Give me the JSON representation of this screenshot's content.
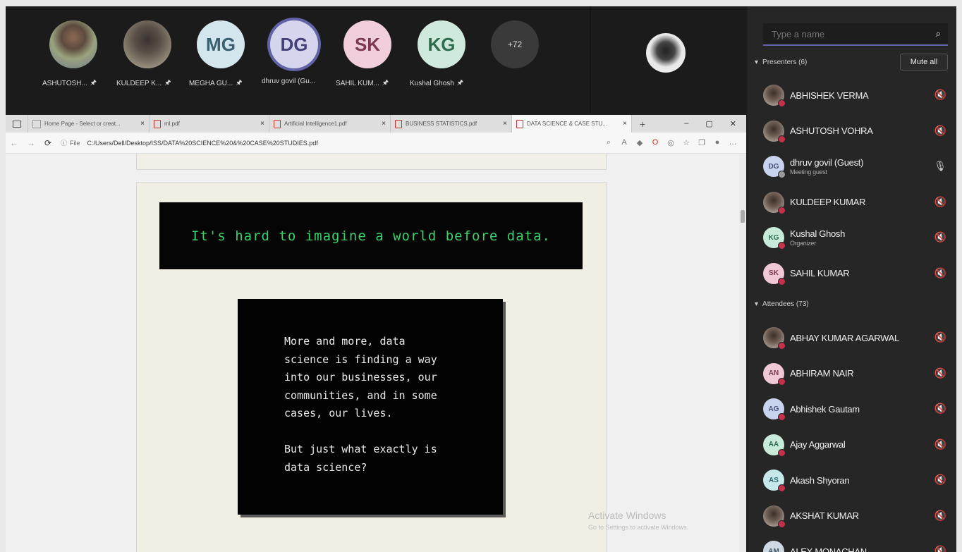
{
  "meeting": {
    "participants": [
      {
        "initials": "",
        "label": "ASHUTOSH...",
        "photo": true
      },
      {
        "initials": "",
        "label": "KULDEEP K...",
        "photo": true
      },
      {
        "initials": "MG",
        "label": "MEGHA GU...",
        "bg": "#d3e6ee",
        "fg": "#3a5f6e"
      },
      {
        "initials": "DG",
        "label": "dhruv govil (Gu...",
        "bg": "#d6d5ee",
        "fg": "#434279",
        "selected": true
      },
      {
        "initials": "SK",
        "label": "SAHIL KUM...",
        "bg": "#f1cedb",
        "fg": "#7a3a52"
      },
      {
        "initials": "KG",
        "label": "Kushal Ghosh",
        "bg": "#cfeadd",
        "fg": "#2f6e4d"
      }
    ],
    "overflow_count": "+72"
  },
  "browser": {
    "tabs": [
      {
        "label": "Home Page - Select or creat..."
      },
      {
        "label": "ml.pdf"
      },
      {
        "label": "Artificial Intelligence1.pdf"
      },
      {
        "label": "BUSINESS STATISTICS.pdf"
      },
      {
        "label": "DATA SCIENCE & CASE STU..."
      }
    ],
    "new_tab": "+",
    "address_prefix": "File",
    "address": "C:/Users/Dell/Desktop/ISS/DATA%20SCIENCE%20&%20CASE%20STUDIES.pdf"
  },
  "pdf": {
    "banner_text": "It's hard to imagine a world before data.",
    "card_text": "More and more, data\nscience is finding a way\ninto our businesses, our\ncommunities, and in some\ncases, our lives.\n\nBut just what exactly is\ndata science?"
  },
  "watermark": {
    "line1": "Activate Windows",
    "line2": "Go to Settings to activate Windows."
  },
  "panel": {
    "search_placeholder": "Type a name",
    "presenters_header": "Presenters (6)",
    "mute_all": "Mute all",
    "attendees_header": "Attendees (73)",
    "presenters": [
      {
        "name": "ABHISHEK VERMA",
        "initials": "",
        "photo": true
      },
      {
        "name": "ASHUTOSH VOHRA",
        "initials": "",
        "photo": true
      },
      {
        "name": "dhruv govil (Guest)",
        "sub": "Meeting guest",
        "initials": "DG",
        "color": "c-blue",
        "mic": "on"
      },
      {
        "name": "KULDEEP KUMAR",
        "initials": "",
        "photo": true
      },
      {
        "name": "Kushal Ghosh",
        "sub": "Organizer",
        "initials": "KG",
        "color": "c-green"
      },
      {
        "name": "SAHIL KUMAR",
        "initials": "SK",
        "color": "c-pink"
      }
    ],
    "attendees": [
      {
        "name": "ABHAY KUMAR AGARWAL",
        "initials": "",
        "photo": true
      },
      {
        "name": "ABHIRAM NAIR",
        "initials": "AN",
        "color": "c-pink"
      },
      {
        "name": "Abhishek Gautam",
        "initials": "AG",
        "color": "c-blue"
      },
      {
        "name": "Ajay Aggarwal",
        "initials": "AA",
        "color": "c-green"
      },
      {
        "name": "Akash Shyoran",
        "initials": "AS",
        "color": "c-teal"
      },
      {
        "name": "AKSHAT KUMAR",
        "initials": "",
        "photo": true
      },
      {
        "name": "ALEX MONACHAN",
        "initials": "AM",
        "color": "c-gray"
      }
    ]
  }
}
